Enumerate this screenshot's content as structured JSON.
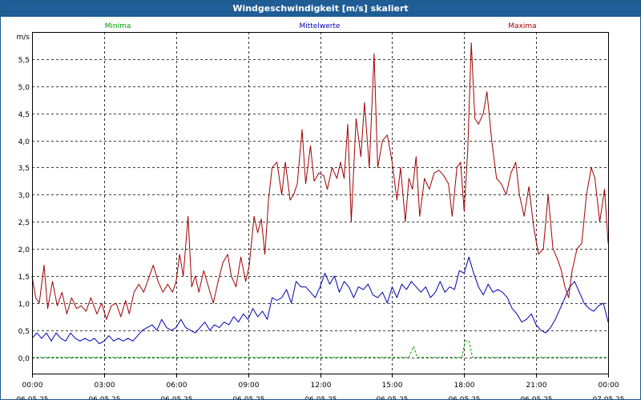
{
  "window": {
    "title": "Windgeschwindigkeit [m/s] skaliert"
  },
  "colors": {
    "background": "#ffffff",
    "grid": "#000000",
    "titlebar": "#1f5d96",
    "minima": "#00a000",
    "mittelwerte": "#0000b4",
    "maxima": "#a00000"
  },
  "chart_data": {
    "type": "line",
    "title": "Windgeschwindigkeit [m/s] skaliert",
    "ylabel": "m/s",
    "xlabel": "",
    "grid": true,
    "legend_position": "top",
    "x_unit": "hours since 00:00 06.05.25",
    "xlim": [
      0,
      24
    ],
    "ylim": [
      -0.3,
      6.0
    ],
    "yticks": [
      0.0,
      0.5,
      1.0,
      1.5,
      2.0,
      2.5,
      3.0,
      3.5,
      4.0,
      4.5,
      5.0,
      5.5
    ],
    "ytick_labels": [
      "0,0",
      "0,5",
      "1,0",
      "1,5",
      "2,0",
      "2,5",
      "3,0",
      "3,5",
      "4,0",
      "4,5",
      "5,0",
      "5,5"
    ],
    "xticks": [
      {
        "x": 0,
        "time": "00:00",
        "date": "06.05.25"
      },
      {
        "x": 3,
        "time": "03:00",
        "date": "06.05.25"
      },
      {
        "x": 6,
        "time": "06:00",
        "date": "06.05.25"
      },
      {
        "x": 9,
        "time": "09:00",
        "date": "06.05.25"
      },
      {
        "x": 12,
        "time": "12:00",
        "date": "06.05.25"
      },
      {
        "x": 15,
        "time": "15:00",
        "date": "06.05.25"
      },
      {
        "x": 18,
        "time": "18:00",
        "date": "06.05.25"
      },
      {
        "x": 21,
        "time": "21:00",
        "date": "06.05.25"
      },
      {
        "x": 24,
        "time": "00:00",
        "date": "07.05.25"
      }
    ],
    "series": [
      {
        "name": "Minima",
        "color": "#00a000",
        "dashed": true,
        "points": [
          [
            0,
            0.0
          ],
          [
            15.7,
            0.0
          ],
          [
            15.9,
            0.2
          ],
          [
            16.05,
            0.0
          ],
          [
            17.9,
            0.0
          ],
          [
            18.05,
            0.3
          ],
          [
            18.2,
            0.3
          ],
          [
            18.35,
            0.0
          ],
          [
            24,
            0.0
          ]
        ]
      },
      {
        "name": "Mittelwerte",
        "color": "#0000b4",
        "dashed": false,
        "points": [
          [
            0,
            0.35
          ],
          [
            0.2,
            0.45
          ],
          [
            0.4,
            0.35
          ],
          [
            0.6,
            0.45
          ],
          [
            0.8,
            0.3
          ],
          [
            1.0,
            0.45
          ],
          [
            1.2,
            0.35
          ],
          [
            1.4,
            0.3
          ],
          [
            1.6,
            0.45
          ],
          [
            1.8,
            0.35
          ],
          [
            2.0,
            0.3
          ],
          [
            2.2,
            0.35
          ],
          [
            2.4,
            0.3
          ],
          [
            2.6,
            0.35
          ],
          [
            2.8,
            0.25
          ],
          [
            3.0,
            0.3
          ],
          [
            3.2,
            0.4
          ],
          [
            3.4,
            0.3
          ],
          [
            3.6,
            0.35
          ],
          [
            3.8,
            0.3
          ],
          [
            4.0,
            0.35
          ],
          [
            4.2,
            0.3
          ],
          [
            4.4,
            0.4
          ],
          [
            4.6,
            0.5
          ],
          [
            4.8,
            0.55
          ],
          [
            5.0,
            0.6
          ],
          [
            5.2,
            0.5
          ],
          [
            5.4,
            0.7
          ],
          [
            5.6,
            0.55
          ],
          [
            5.8,
            0.5
          ],
          [
            6.0,
            0.55
          ],
          [
            6.2,
            0.7
          ],
          [
            6.4,
            0.55
          ],
          [
            6.6,
            0.5
          ],
          [
            6.8,
            0.45
          ],
          [
            7.0,
            0.55
          ],
          [
            7.2,
            0.65
          ],
          [
            7.4,
            0.5
          ],
          [
            7.6,
            0.6
          ],
          [
            7.8,
            0.55
          ],
          [
            8.0,
            0.65
          ],
          [
            8.2,
            0.6
          ],
          [
            8.4,
            0.75
          ],
          [
            8.6,
            0.65
          ],
          [
            8.8,
            0.8
          ],
          [
            9.0,
            0.7
          ],
          [
            9.2,
            0.9
          ],
          [
            9.4,
            0.75
          ],
          [
            9.6,
            0.85
          ],
          [
            9.8,
            0.7
          ],
          [
            10.0,
            1.1
          ],
          [
            10.2,
            1.05
          ],
          [
            10.4,
            1.1
          ],
          [
            10.6,
            1.25
          ],
          [
            10.8,
            1.0
          ],
          [
            11.0,
            1.4
          ],
          [
            11.2,
            1.3
          ],
          [
            11.4,
            1.3
          ],
          [
            11.6,
            1.2
          ],
          [
            11.8,
            1.1
          ],
          [
            12.0,
            1.3
          ],
          [
            12.2,
            1.55
          ],
          [
            12.4,
            1.35
          ],
          [
            12.6,
            1.5
          ],
          [
            12.8,
            1.2
          ],
          [
            13.0,
            1.4
          ],
          [
            13.2,
            1.3
          ],
          [
            13.4,
            1.1
          ],
          [
            13.6,
            1.3
          ],
          [
            13.8,
            1.25
          ],
          [
            14.0,
            1.35
          ],
          [
            14.2,
            1.15
          ],
          [
            14.4,
            1.1
          ],
          [
            14.6,
            1.2
          ],
          [
            14.8,
            1.0
          ],
          [
            15.0,
            1.3
          ],
          [
            15.2,
            1.1
          ],
          [
            15.4,
            1.35
          ],
          [
            15.6,
            1.25
          ],
          [
            15.8,
            1.4
          ],
          [
            16.0,
            1.3
          ],
          [
            16.2,
            1.2
          ],
          [
            16.4,
            1.3
          ],
          [
            16.6,
            1.1
          ],
          [
            16.8,
            1.2
          ],
          [
            17.0,
            1.4
          ],
          [
            17.2,
            1.2
          ],
          [
            17.4,
            1.3
          ],
          [
            17.6,
            1.25
          ],
          [
            17.8,
            1.6
          ],
          [
            18.0,
            1.55
          ],
          [
            18.2,
            1.85
          ],
          [
            18.4,
            1.55
          ],
          [
            18.6,
            1.3
          ],
          [
            18.8,
            1.15
          ],
          [
            19.0,
            1.35
          ],
          [
            19.2,
            1.2
          ],
          [
            19.4,
            1.25
          ],
          [
            19.6,
            1.2
          ],
          [
            19.8,
            1.1
          ],
          [
            20.0,
            0.9
          ],
          [
            20.2,
            0.8
          ],
          [
            20.4,
            0.65
          ],
          [
            20.6,
            0.7
          ],
          [
            20.8,
            0.8
          ],
          [
            21.0,
            0.6
          ],
          [
            21.2,
            0.5
          ],
          [
            21.4,
            0.45
          ],
          [
            21.6,
            0.55
          ],
          [
            21.8,
            0.7
          ],
          [
            22.0,
            0.9
          ],
          [
            22.2,
            1.1
          ],
          [
            22.4,
            1.3
          ],
          [
            22.6,
            1.4
          ],
          [
            22.8,
            1.2
          ],
          [
            23.0,
            1.0
          ],
          [
            23.2,
            0.9
          ],
          [
            23.4,
            0.85
          ],
          [
            23.6,
            0.95
          ],
          [
            23.8,
            1.0
          ],
          [
            24.0,
            0.65
          ]
        ]
      },
      {
        "name": "Maxima",
        "color": "#a00000",
        "dashed": false,
        "points": [
          [
            0,
            1.5
          ],
          [
            0.15,
            1.1
          ],
          [
            0.3,
            1.0
          ],
          [
            0.5,
            1.7
          ],
          [
            0.65,
            0.9
          ],
          [
            0.85,
            1.4
          ],
          [
            1.05,
            0.95
          ],
          [
            1.25,
            1.2
          ],
          [
            1.45,
            0.8
          ],
          [
            1.65,
            1.1
          ],
          [
            1.85,
            0.9
          ],
          [
            2.05,
            0.95
          ],
          [
            2.25,
            0.85
          ],
          [
            2.45,
            1.1
          ],
          [
            2.7,
            0.8
          ],
          [
            2.9,
            1.0
          ],
          [
            3.1,
            0.7
          ],
          [
            3.3,
            0.95
          ],
          [
            3.5,
            1.0
          ],
          [
            3.7,
            0.75
          ],
          [
            3.9,
            1.05
          ],
          [
            4.05,
            0.8
          ],
          [
            4.25,
            1.2
          ],
          [
            4.45,
            1.35
          ],
          [
            4.65,
            1.2
          ],
          [
            4.85,
            1.45
          ],
          [
            5.05,
            1.7
          ],
          [
            5.25,
            1.4
          ],
          [
            5.45,
            1.2
          ],
          [
            5.65,
            1.35
          ],
          [
            5.85,
            1.2
          ],
          [
            6.0,
            1.4
          ],
          [
            6.15,
            1.9
          ],
          [
            6.3,
            1.5
          ],
          [
            6.5,
            2.6
          ],
          [
            6.65,
            1.3
          ],
          [
            6.8,
            1.5
          ],
          [
            6.95,
            1.2
          ],
          [
            7.15,
            1.6
          ],
          [
            7.35,
            1.3
          ],
          [
            7.55,
            1.0
          ],
          [
            7.75,
            1.4
          ],
          [
            7.95,
            1.75
          ],
          [
            8.15,
            1.9
          ],
          [
            8.3,
            1.5
          ],
          [
            8.5,
            1.3
          ],
          [
            8.7,
            1.85
          ],
          [
            8.9,
            1.4
          ],
          [
            9.05,
            1.7
          ],
          [
            9.25,
            2.6
          ],
          [
            9.4,
            2.3
          ],
          [
            9.55,
            2.55
          ],
          [
            9.7,
            1.9
          ],
          [
            9.85,
            2.9
          ],
          [
            10.0,
            3.5
          ],
          [
            10.2,
            3.6
          ],
          [
            10.4,
            3.0
          ],
          [
            10.55,
            3.6
          ],
          [
            10.75,
            2.9
          ],
          [
            10.9,
            3.0
          ],
          [
            11.05,
            3.2
          ],
          [
            11.25,
            4.2
          ],
          [
            11.4,
            3.2
          ],
          [
            11.6,
            3.9
          ],
          [
            11.75,
            3.25
          ],
          [
            11.95,
            3.4
          ],
          [
            12.15,
            3.35
          ],
          [
            12.3,
            3.1
          ],
          [
            12.5,
            3.5
          ],
          [
            12.7,
            3.3
          ],
          [
            12.85,
            3.6
          ],
          [
            13.0,
            3.3
          ],
          [
            13.15,
            4.3
          ],
          [
            13.3,
            2.5
          ],
          [
            13.5,
            4.4
          ],
          [
            13.7,
            3.7
          ],
          [
            13.85,
            4.7
          ],
          [
            14.05,
            3.5
          ],
          [
            14.25,
            5.6
          ],
          [
            14.4,
            3.5
          ],
          [
            14.6,
            4.0
          ],
          [
            14.8,
            4.1
          ],
          [
            15.0,
            3.6
          ],
          [
            15.2,
            2.9
          ],
          [
            15.35,
            3.5
          ],
          [
            15.55,
            2.5
          ],
          [
            15.7,
            3.3
          ],
          [
            15.85,
            3.1
          ],
          [
            16.0,
            3.7
          ],
          [
            16.15,
            2.6
          ],
          [
            16.35,
            3.3
          ],
          [
            16.55,
            3.1
          ],
          [
            16.75,
            3.4
          ],
          [
            16.95,
            3.45
          ],
          [
            17.15,
            3.35
          ],
          [
            17.35,
            3.2
          ],
          [
            17.5,
            2.6
          ],
          [
            17.7,
            3.5
          ],
          [
            17.85,
            3.6
          ],
          [
            18.0,
            2.7
          ],
          [
            18.15,
            3.8
          ],
          [
            18.3,
            5.8
          ],
          [
            18.45,
            4.4
          ],
          [
            18.6,
            4.3
          ],
          [
            18.8,
            4.5
          ],
          [
            18.95,
            4.9
          ],
          [
            19.15,
            4.0
          ],
          [
            19.35,
            3.3
          ],
          [
            19.55,
            3.2
          ],
          [
            19.75,
            3.0
          ],
          [
            19.95,
            3.4
          ],
          [
            20.15,
            3.6
          ],
          [
            20.3,
            3.0
          ],
          [
            20.5,
            2.6
          ],
          [
            20.7,
            3.15
          ],
          [
            20.9,
            2.4
          ],
          [
            21.1,
            1.9
          ],
          [
            21.3,
            2.0
          ],
          [
            21.5,
            3.0
          ],
          [
            21.7,
            2.0
          ],
          [
            21.9,
            1.8
          ],
          [
            22.05,
            1.6
          ],
          [
            22.2,
            1.3
          ],
          [
            22.35,
            1.1
          ],
          [
            22.5,
            1.6
          ],
          [
            22.7,
            2.0
          ],
          [
            22.9,
            2.1
          ],
          [
            23.1,
            3.0
          ],
          [
            23.3,
            3.5
          ],
          [
            23.45,
            3.3
          ],
          [
            23.65,
            2.5
          ],
          [
            23.85,
            3.1
          ],
          [
            24.0,
            2.1
          ]
        ]
      }
    ]
  }
}
